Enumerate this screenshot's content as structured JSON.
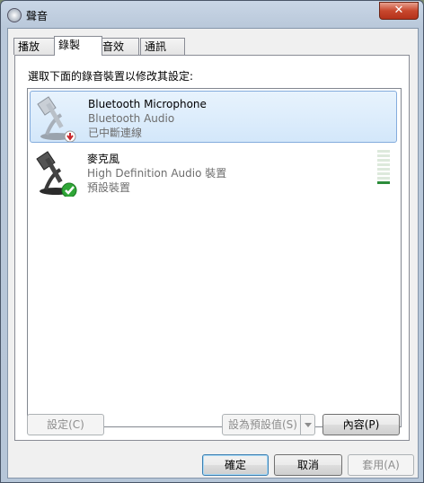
{
  "window": {
    "title": "聲音",
    "close_glyph": "✕"
  },
  "tabs": [
    {
      "label": "播放",
      "active": false
    },
    {
      "label": "錄製",
      "active": true
    },
    {
      "label": "音效",
      "active": false
    },
    {
      "label": "通訊",
      "active": false
    }
  ],
  "instruction": "選取下面的錄音裝置以修改其設定:",
  "devices": [
    {
      "name": "Bluetooth Microphone",
      "driver": "Bluetooth Audio",
      "status": "已中斷連線",
      "icon": "microphone-disconnected-icon",
      "selected": true
    },
    {
      "name": "麥克風",
      "driver": "High Definition Audio 裝置",
      "status": "預設裝置",
      "icon": "microphone-default-icon",
      "selected": false,
      "level_fraction": 0.1
    }
  ],
  "buttons": {
    "configure": "設定(C)",
    "set_default": "設為預設值(S)",
    "properties": "內容(P)",
    "ok": "確定",
    "cancel": "取消",
    "apply": "套用(A)"
  },
  "colors": {
    "selection": "#d3e7fa",
    "meter_on": "#2c8c3a",
    "check": "#2fa637",
    "disconnect": "#c8262b"
  }
}
